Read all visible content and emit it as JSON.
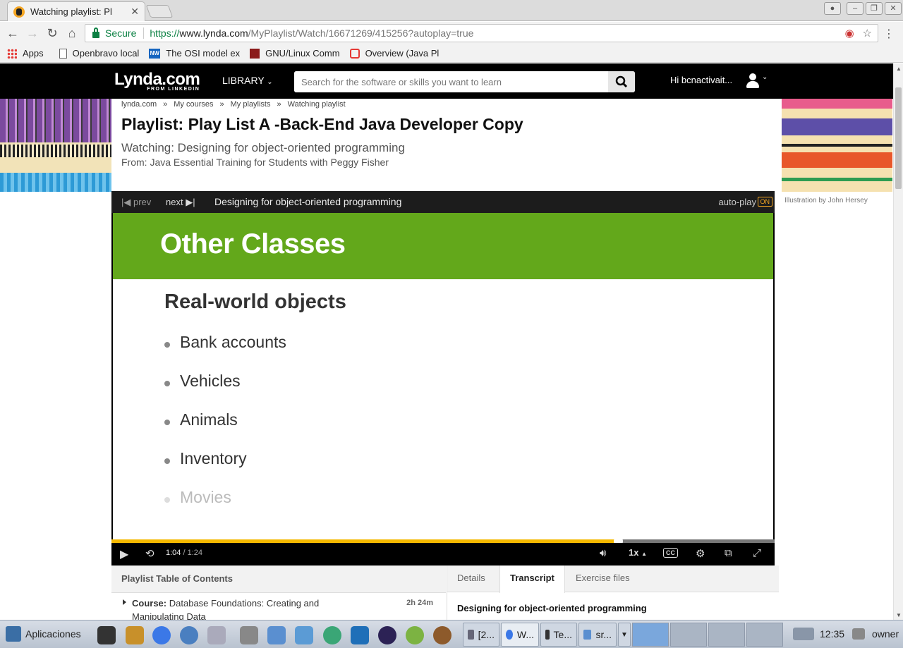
{
  "browser": {
    "tab_title": "Watching playlist: Pl",
    "tab_close": "✕",
    "window_controls": [
      "–",
      "❐",
      "✕"
    ],
    "secure_label": "Secure",
    "url_scheme": "https://",
    "url_host": "www.lynda.com",
    "url_path": "/MyPlaylist/Watch/16671269/415256?autoplay=true",
    "bookmarks": [
      {
        "label": "Apps",
        "icon": "apps-grid-icon"
      },
      {
        "label": "Openbravo local",
        "icon": "page-icon"
      },
      {
        "label": "The OSI model ex",
        "icon": "nw-site-icon"
      },
      {
        "label": "GNU/Linux Comm",
        "icon": "gnu-site-icon"
      },
      {
        "label": "Overview (Java Pl",
        "icon": "oracle-site-icon"
      }
    ]
  },
  "site": {
    "logo_main": "Lynda.com",
    "logo_sub": "FROM LINKEDIN",
    "library_label": "LIBRARY",
    "search_placeholder": "Search for the software or skills you want to learn",
    "user_greeting": "Hi bcnactivait..."
  },
  "breadcrumbs": [
    "lynda.com",
    "My courses",
    "My playlists",
    "Watching playlist"
  ],
  "breadcrumb_sep": "»",
  "page": {
    "title": "Playlist: Play List A -Back-End Java Developer Copy",
    "watching": "Watching: Designing for object-oriented programming",
    "from": "From: Java Essential Training for Students with Peggy Fisher",
    "illustration_credit": "Illustration by John Hersey"
  },
  "player": {
    "prev_label": "prev",
    "next_label": "next",
    "video_title": "Designing for object-oriented programming",
    "autoplay_label": "auto-play",
    "autoplay_state": "ON",
    "slide": {
      "title": "Other Classes",
      "subtitle": "Real-world objects",
      "bullets": [
        "Bank accounts",
        "Vehicles",
        "Animals",
        "Inventory",
        "Movies"
      ]
    },
    "current_time": "1:04",
    "time_sep": " / ",
    "duration": "1:24",
    "progress_fraction": 0.764,
    "speed": "1x",
    "accent_color": "#f5b800"
  },
  "toc": {
    "header": "Playlist Table of Contents",
    "item_prefix": "Course:",
    "item_title": "Database Foundations: Creating and Manipulating Data",
    "item_duration": "2h 24m"
  },
  "panel_tabs": [
    "Details",
    "Transcript",
    "Exercise files"
  ],
  "transcript_title": "Designing for object-oriented programming",
  "taskbar": {
    "apps_label": "Aplicaciones",
    "tasks": [
      "[2...",
      "W...",
      "Te...",
      "sr..."
    ],
    "clock": "12:35",
    "user": "owner"
  }
}
